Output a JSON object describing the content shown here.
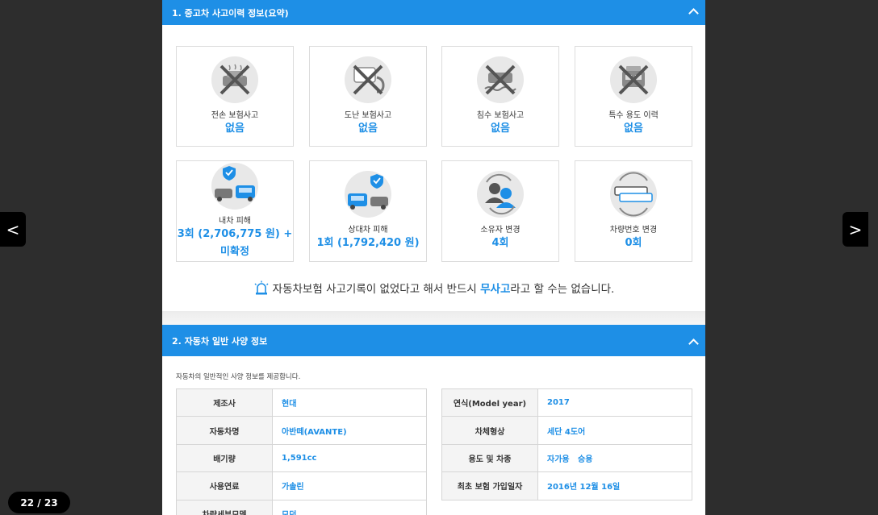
{
  "section1": {
    "title": "1. 중고차 사고이력 정보(요약)"
  },
  "cards_row1": [
    {
      "label": "전손 보험사고",
      "value": "없음",
      "icon": "car-total-loss-crossed-icon"
    },
    {
      "label": "도난 보험사고",
      "value": "없음",
      "icon": "car-theft-crossed-icon"
    },
    {
      "label": "침수 보험사고",
      "value": "없음",
      "icon": "car-flood-crossed-icon"
    },
    {
      "label": "특수 용도 이력",
      "value": "없음",
      "icon": "special-use-crossed-icon"
    }
  ],
  "cards_row2": [
    {
      "label": "내차 피해",
      "value_line1": "3회 (2,706,775 원) +",
      "value_line2": "미확정",
      "icon": "my-car-damage-icon"
    },
    {
      "label": "상대차 피해",
      "value": "1회 (1,792,420 원)",
      "icon": "other-car-damage-icon"
    },
    {
      "label": "소유자 변경",
      "value": "4회",
      "icon": "owner-change-icon"
    },
    {
      "label": "차량번호 변경",
      "value": "0회",
      "icon": "plate-change-icon"
    }
  ],
  "note": {
    "before": "자동차보험 사고기록이 없었다고 해서 반드시 ",
    "highlight": "무사고",
    "after": "라고 할 수는 없습니다."
  },
  "section2": {
    "title": "2. 자동차 일반 사양 정보",
    "intro": "자동차의 일반적인 사양 정보를 제공합니다."
  },
  "spec_left": [
    {
      "key": "제조사",
      "value": "현대"
    },
    {
      "key": "자동차명",
      "value": "아반떼(AVANTE)"
    },
    {
      "key": "배기량",
      "value": "1,591cc"
    },
    {
      "key": "사용연료",
      "value": "가솔린"
    },
    {
      "key": "차량세부모델",
      "value": "모던"
    }
  ],
  "spec_right": [
    {
      "key": "연식(Model year)",
      "value": "2017"
    },
    {
      "key": "차체형상",
      "value": "세단 4도어"
    },
    {
      "key": "용도 및 차종",
      "value": "자가용   승용"
    },
    {
      "key": "최초 보험 가입일자",
      "value": "2016년 12월 16일"
    }
  ],
  "viewer": {
    "prev": "<",
    "next": ">",
    "page_counter": "22 / 23"
  },
  "colors": {
    "accent": "#1e8fe6",
    "backdrop": "#2d2d2d"
  }
}
